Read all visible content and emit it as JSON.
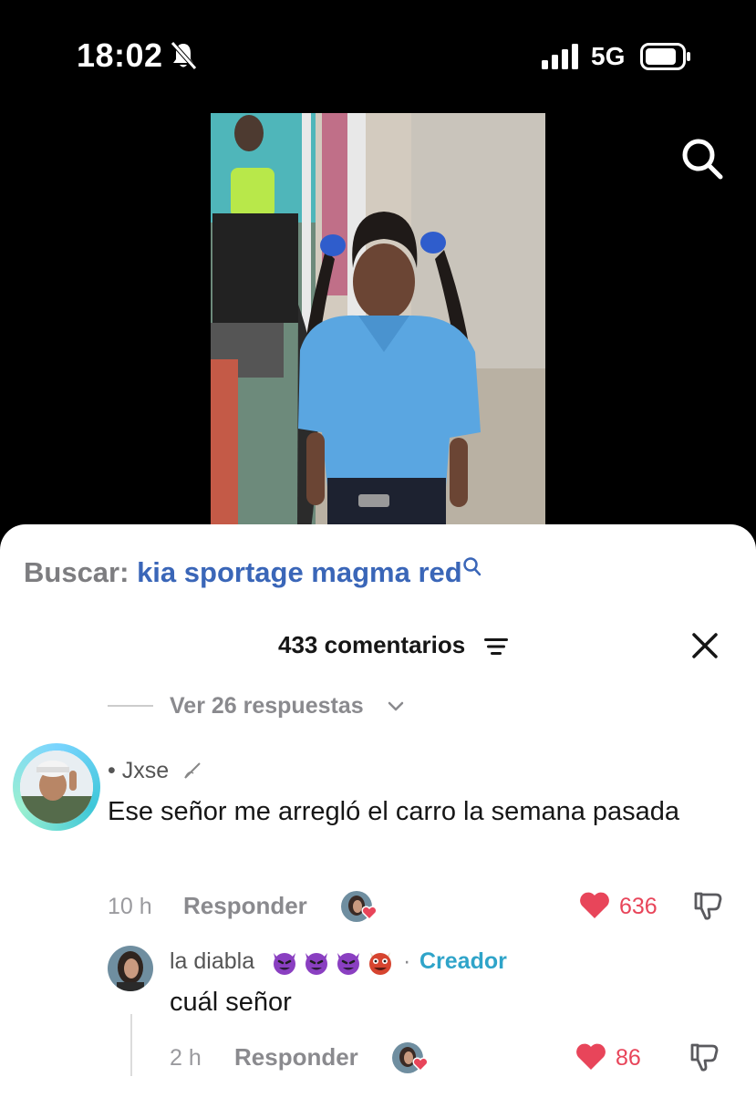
{
  "status": {
    "time": "18:02",
    "network": "5G"
  },
  "search": {
    "label": "Buscar:",
    "query": "kia sportage magma red"
  },
  "comments": {
    "count_label": "433 comentarios",
    "view_replies": "Ver 26 respuestas",
    "main": {
      "username": "• Jxse",
      "text": "Ese señor me arregló el carro la semana pasada",
      "time": "10 h",
      "reply_label": "Responder",
      "likes": "636"
    },
    "reply": {
      "username": "la diabla",
      "separator": "·",
      "badge": "Creador",
      "text": "cuál señor",
      "time": "2 h",
      "reply_label": "Responder",
      "likes": "86"
    }
  },
  "colors": {
    "like": "#e8455a",
    "creator": "#2fa4c9",
    "search_query": "#3a66b8"
  },
  "icons": [
    "bell-off-icon",
    "signal-icon",
    "battery-icon",
    "search-icon",
    "sort-icon",
    "close-icon",
    "chevron-down-icon",
    "heart-icon",
    "dislike-icon",
    "devil-emoji",
    "ogre-emoji"
  ]
}
